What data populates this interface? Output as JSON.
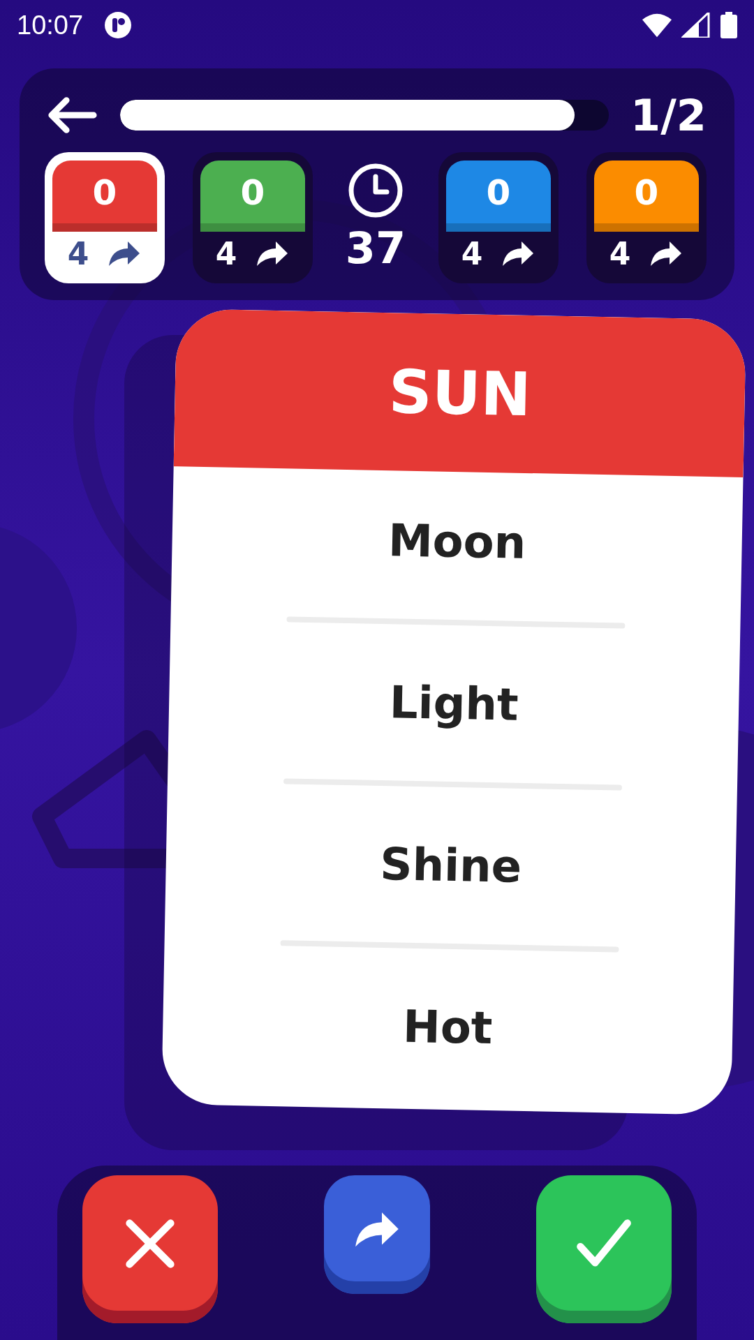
{
  "status_bar": {
    "time": "10:07"
  },
  "progress": {
    "level": 0.93,
    "counter": "1/2"
  },
  "teams": [
    {
      "score": "0",
      "skips": "4",
      "color": "#e53935",
      "selected": true
    },
    {
      "score": "0",
      "skips": "4",
      "color": "#4caf50",
      "selected": false
    },
    {
      "score": "0",
      "skips": "4",
      "color": "#1e88e5",
      "selected": false
    },
    {
      "score": "0",
      "skips": "4",
      "color": "#fb8c00",
      "selected": false
    }
  ],
  "timer": {
    "seconds": "37"
  },
  "card": {
    "word": "SUN",
    "taboo_words": [
      "Moon",
      "Light",
      "Shine",
      "Hot"
    ]
  }
}
